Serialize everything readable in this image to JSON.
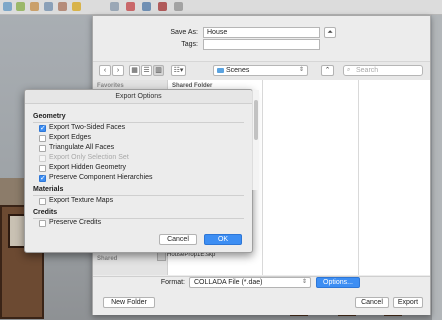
{
  "save_dialog": {
    "save_as_label": "Save As:",
    "save_as_value": "House",
    "tags_label": "Tags:",
    "tags_value": "",
    "expand_glyph": "⏶",
    "nav_back": "‹",
    "nav_forward": "›",
    "location": "Scenes",
    "search_placeholder": "Search",
    "sidebar_heading": "Favorites",
    "sidebar_shared": "Shared",
    "column_heading": "Shared Folder",
    "visible_file": "HouseProp1E.skp",
    "format_label": "Format:",
    "format_value": "COLLADA File (*.dae)",
    "options_button": "Options...",
    "new_folder_button": "New Folder",
    "cancel_button": "Cancel",
    "export_button": "Export"
  },
  "export_options": {
    "title": "Export Options",
    "geometry_heading": "Geometry",
    "geometry_options": [
      {
        "label": "Export Two-Sided Faces",
        "checked": true,
        "enabled": true
      },
      {
        "label": "Export Edges",
        "checked": false,
        "enabled": true
      },
      {
        "label": "Triangulate All Faces",
        "checked": false,
        "enabled": true
      },
      {
        "label": "Export Only Selection Set",
        "checked": false,
        "enabled": false
      },
      {
        "label": "Export Hidden Geometry",
        "checked": false,
        "enabled": true
      },
      {
        "label": "Preserve Component Hierarchies",
        "checked": true,
        "enabled": true
      }
    ],
    "materials_heading": "Materials",
    "materials_options": [
      {
        "label": "Export Texture Maps",
        "checked": false,
        "enabled": true
      }
    ],
    "credits_heading": "Credits",
    "credits_options": [
      {
        "label": "Preserve Credits",
        "checked": false,
        "enabled": true
      }
    ],
    "cancel_button": "Cancel",
    "ok_button": "OK"
  },
  "colors": {
    "accent": "#3d8ef3",
    "dialog_bg": "#ececec"
  }
}
